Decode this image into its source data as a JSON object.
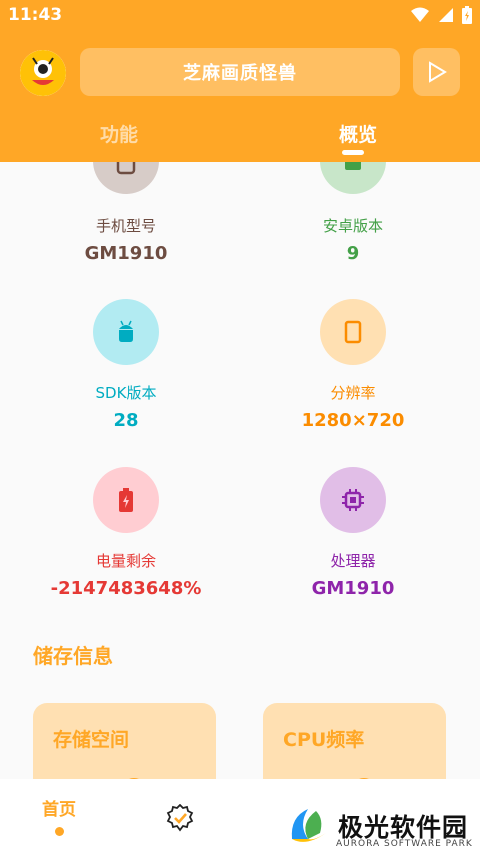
{
  "status": {
    "time": "11:43"
  },
  "header": {
    "title": "芝麻画质怪兽",
    "tabs": [
      {
        "label": "功能"
      },
      {
        "label": "概览"
      }
    ]
  },
  "overview": {
    "items": [
      {
        "label": "手机型号",
        "value": "GM1910",
        "icon": "phone-icon",
        "label_color": "#6d4c41",
        "value_color": "#6d4c41",
        "circle_color": "#d7ccc8"
      },
      {
        "label": "安卓版本",
        "value": "9",
        "icon": "android-icon",
        "label_color": "#43a047",
        "value_color": "#43a047",
        "circle_color": "#c8e6c9"
      },
      {
        "label": "SDK版本",
        "value": "28",
        "icon": "android-icon",
        "label_color": "#00acc1",
        "value_color": "#00acc1",
        "circle_color": "#b2ebf2"
      },
      {
        "label": "分辨率",
        "value": "1280×720",
        "icon": "screen-icon",
        "label_color": "#fb8c00",
        "value_color": "#fb8c00",
        "circle_color": "#ffe0b2"
      },
      {
        "label": "电量剩余",
        "value": "-2147483648%",
        "icon": "battery-icon",
        "label_color": "#e53935",
        "value_color": "#e53935",
        "circle_color": "#ffcdd2"
      },
      {
        "label": "处理器",
        "value": "GM1910",
        "icon": "cpu-icon",
        "label_color": "#8e24aa",
        "value_color": "#8e24aa",
        "circle_color": "#e1bee7"
      }
    ]
  },
  "storage": {
    "section_title": "储存信息",
    "cards": [
      {
        "title": "存储空间"
      },
      {
        "title": "CPU频率"
      }
    ]
  },
  "bottom_nav": {
    "home_label": "首页"
  },
  "watermark": {
    "text": "极光软件园",
    "sub": "AURORA SOFTWARE PARK"
  },
  "colors": {
    "accent": "#ffa726"
  }
}
